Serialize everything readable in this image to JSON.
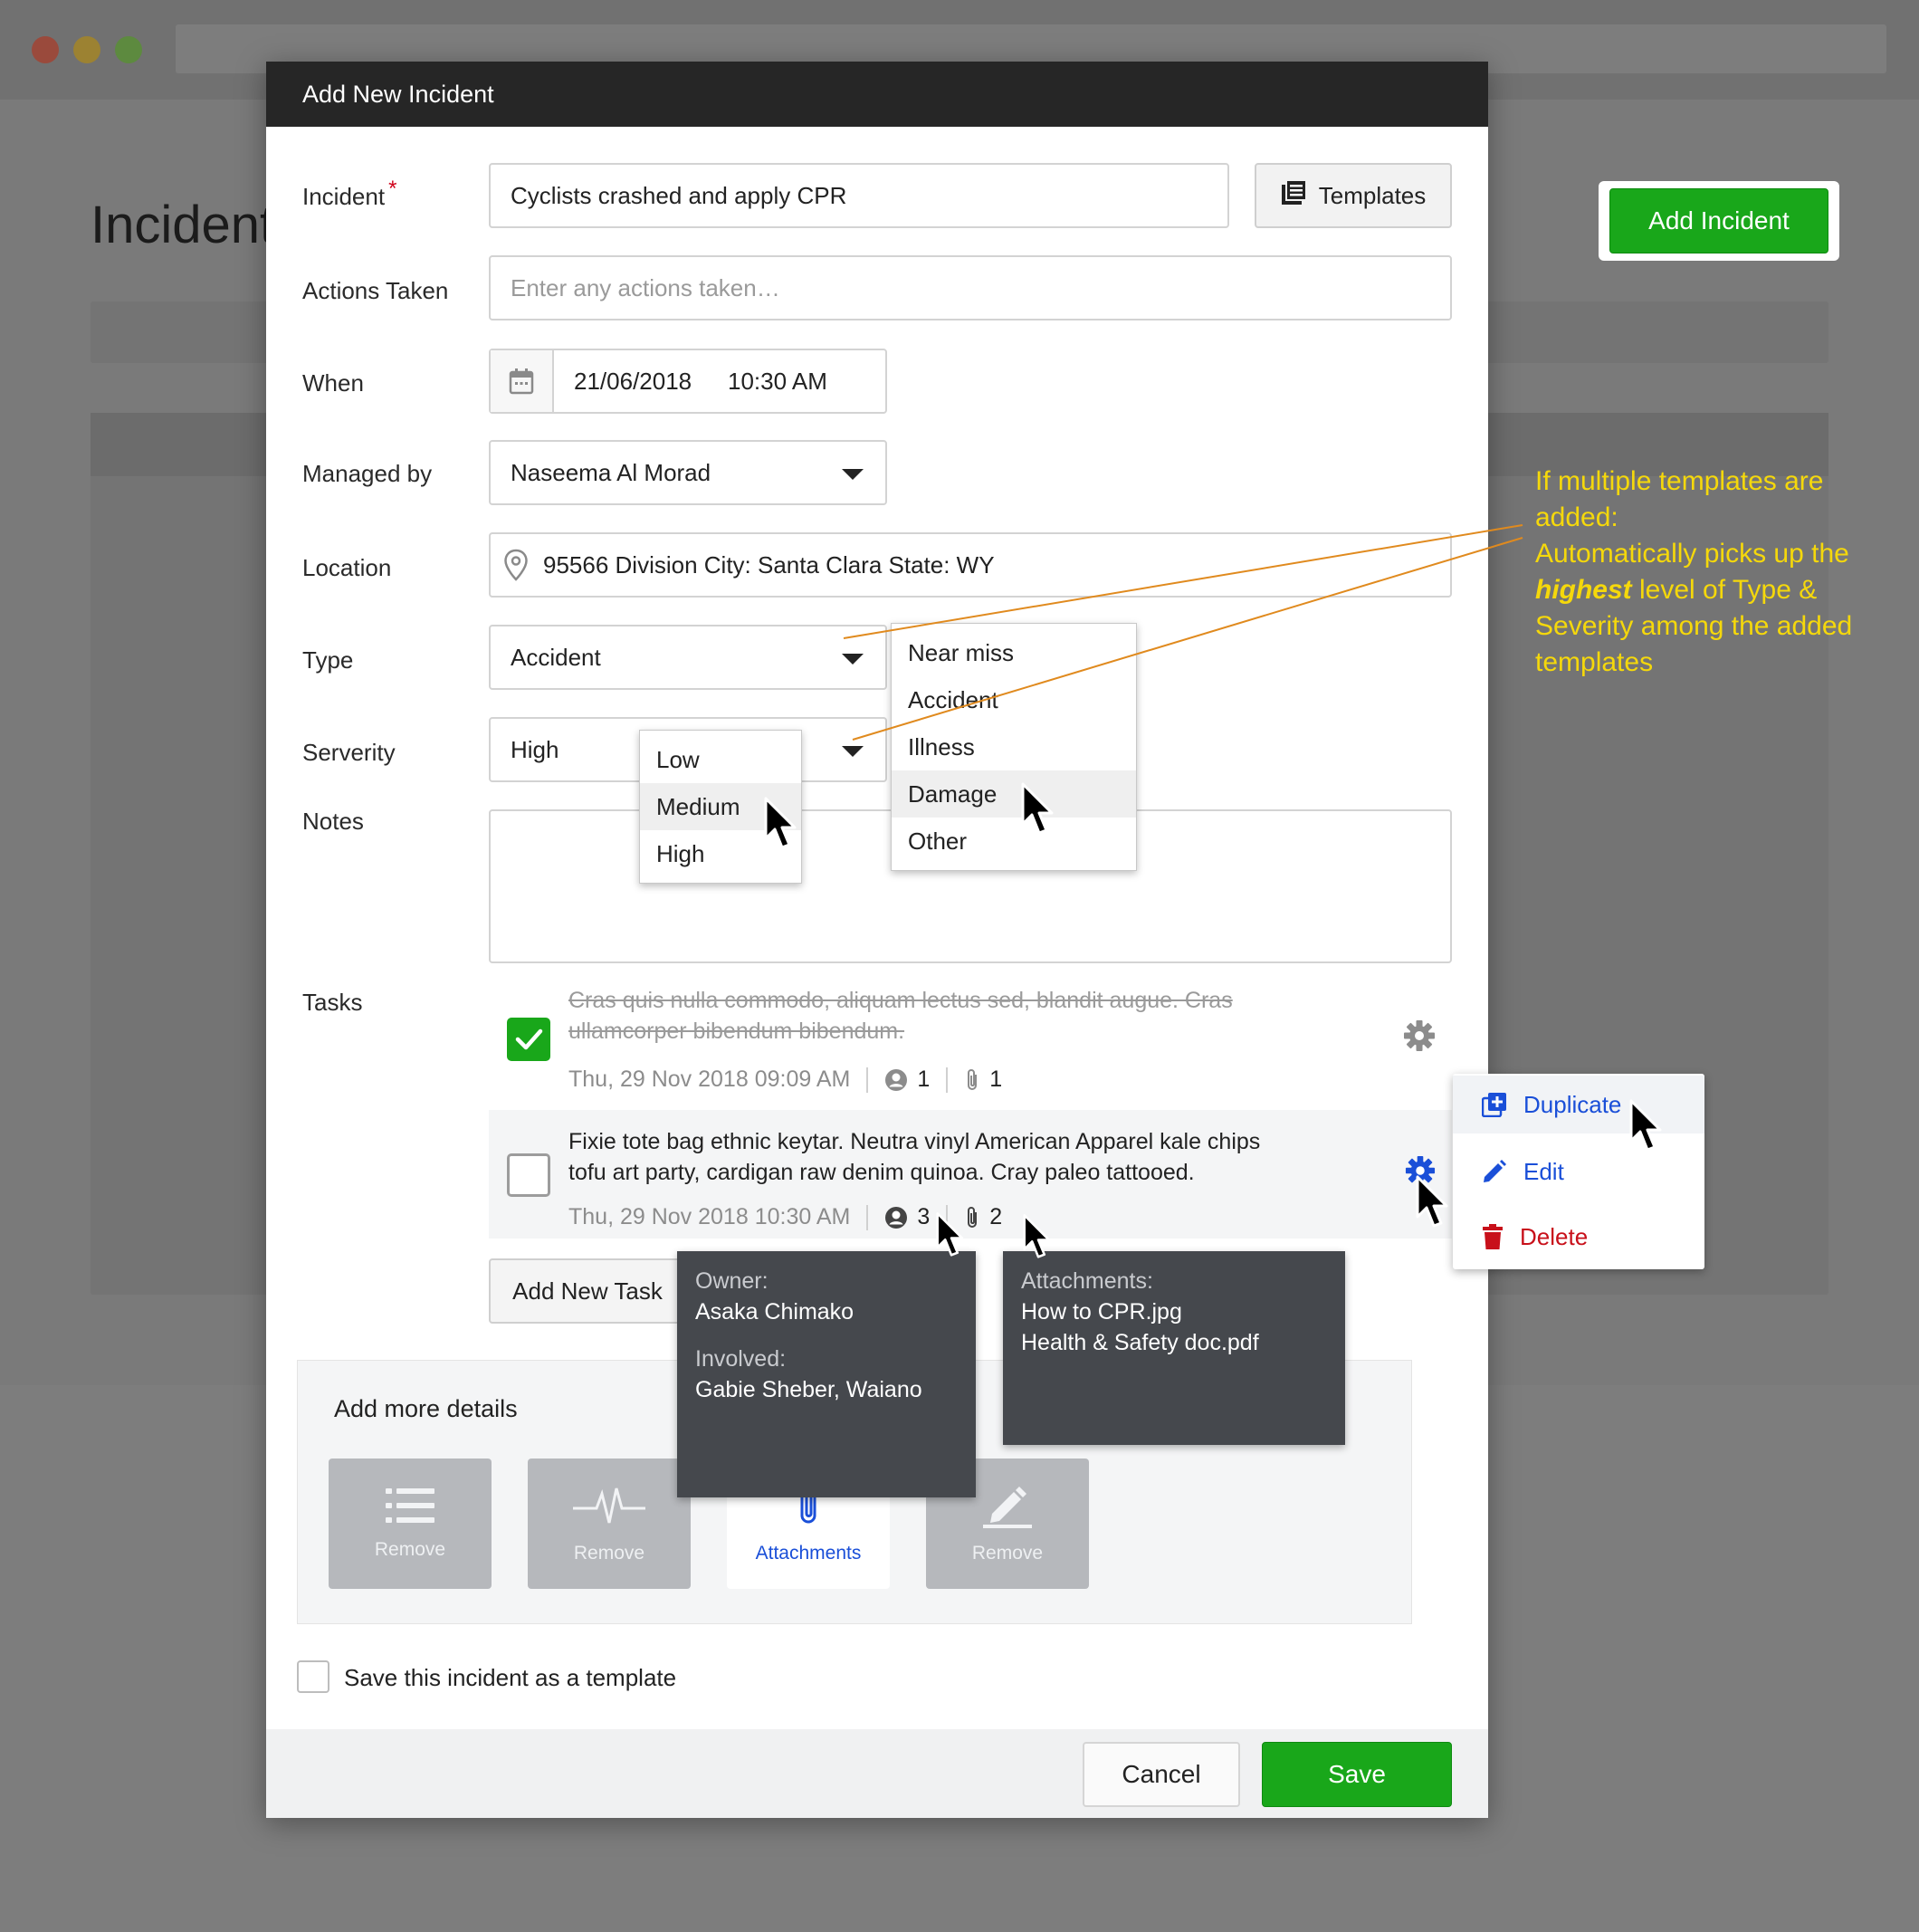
{
  "background": {
    "page_title": "Incident",
    "add_incident_label": "Add Incident"
  },
  "modal": {
    "title": "Add New Incident",
    "incident": {
      "label": "Incident",
      "required_mark": "*",
      "value": "Cyclists crashed and apply CPR",
      "templates_label": "Templates"
    },
    "actions_taken": {
      "label": "Actions Taken",
      "placeholder": "Enter any actions taken…"
    },
    "when": {
      "label": "When",
      "date": "21/06/2018",
      "time": "10:30 AM"
    },
    "managed_by": {
      "label": "Managed by",
      "value": "Naseema Al Morad"
    },
    "location": {
      "label": "Location",
      "value": "95566 Division City: Santa Clara State: WY"
    },
    "type": {
      "label": "Type",
      "value": "Accident",
      "options": [
        "Near miss",
        "Accident",
        "Illness",
        "Damage",
        "Other"
      ],
      "hovered": "Damage"
    },
    "severity": {
      "label": "Serverity",
      "value": "High",
      "options": [
        "Low",
        "Medium",
        "High"
      ],
      "hovered": "Medium"
    },
    "notes": {
      "label": "Notes"
    },
    "tasks": {
      "label": "Tasks",
      "items": [
        {
          "text_line1": "Cras quis nulla commodo, aliquam lectus sed, blandit augue. Cras",
          "text_line2": "ullamcorper bibendum bibendum.",
          "date": "Thu, 29 Nov 2018 09:09 AM",
          "people": "1",
          "attachments": "1",
          "done": true
        },
        {
          "text_line1": "Fixie tote bag ethnic keytar. Neutra vinyl American Apparel kale chips",
          "text_line2": "tofu art party, cardigan raw denim quinoa. Cray paleo tattooed.",
          "date": "Thu, 29 Nov 2018 10:30 AM",
          "people": "3",
          "attachments": "2",
          "done": false
        }
      ],
      "add_label": "Add New Task"
    },
    "owner_tooltip": {
      "owner_label": "Owner:",
      "owner": "Asaka Chimako",
      "involved_label": "Involved:",
      "involved": "Gabie Sheber, Waiano"
    },
    "attachments_tooltip": {
      "label": "Attachments:",
      "files": [
        "How to CPR.jpg",
        "Health & Safety doc.pdf"
      ]
    },
    "more_details": {
      "title": "Add more details",
      "tiles": [
        {
          "icon": "list-icon",
          "label": "Remove"
        },
        {
          "icon": "pulse-icon",
          "label": "Remove"
        },
        {
          "icon": "paperclip-icon",
          "label": "Attachments"
        },
        {
          "icon": "pencil-icon",
          "label": "Remove"
        }
      ]
    },
    "save_template_label": "Save this incident as a template",
    "cancel_label": "Cancel",
    "save_label": "Save"
  },
  "gear_menu": {
    "duplicate": "Duplicate",
    "edit": "Edit",
    "delete": "Delete"
  },
  "annotation": {
    "line1": "If multiple templates are added:",
    "line2_pre": "Automatically picks up the",
    "line2_em": "highest",
    "line2_post": "level of Type & Severity among the added templates"
  },
  "colors": {
    "primary_green": "#19a71a",
    "link_blue": "#1a4fd8",
    "danger_red": "#c8101a",
    "header_dark": "#262626",
    "annotation_yellow": "#f5d80b"
  }
}
